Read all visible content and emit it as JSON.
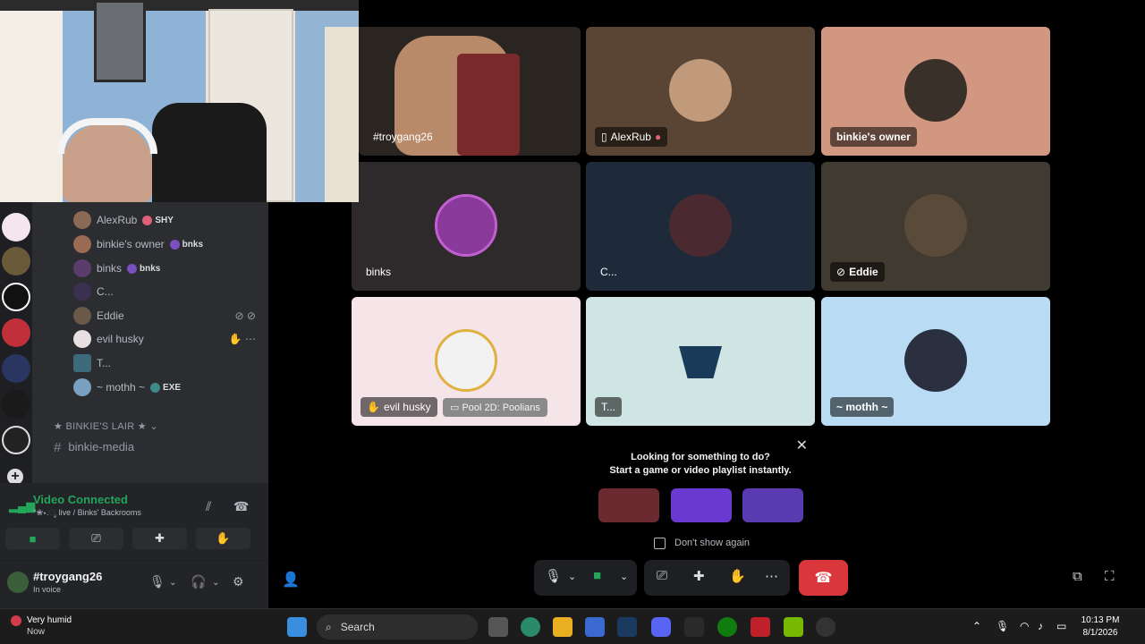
{
  "voice_users": [
    {
      "name": "AlexRub",
      "tag": "SHY",
      "avatar_color": "#8b6a55",
      "tag_color": "#e0607a"
    },
    {
      "name": "binkie's owner",
      "tag": "bnks",
      "avatar_color": "#9a6a55",
      "tag_color": "#7a4fbf"
    },
    {
      "name": "binks",
      "tag": "bnks",
      "avatar_color": "#5a3d6a",
      "tag_color": "#7a4fbf"
    },
    {
      "name": "C...",
      "tag": "",
      "avatar_color": "#3a3050",
      "tag_color": ""
    },
    {
      "name": "Eddie",
      "tag": "",
      "avatar_color": "#6b5a4a",
      "tag_color": ""
    },
    {
      "name": "evil husky",
      "tag": "",
      "avatar_color": "#e8e0e0",
      "tag_color": ""
    },
    {
      "name": "T...",
      "tag": "",
      "avatar_color": "#3c6a7a",
      "tag_color": ""
    },
    {
      "name": "~ mothh ~",
      "tag": "EXE",
      "avatar_color": "#7aa0c0",
      "tag_color": "#3c8a8a"
    }
  ],
  "channels": {
    "category": "★ BINKIE'S LAIR ★",
    "text_channel": "binkie-media"
  },
  "voice_panel": {
    "status": "Video Connected",
    "location": "°❀⋆.ೃ live / Binks' Backrooms"
  },
  "user_bar": {
    "username": "#troygang26",
    "status": "In voice"
  },
  "tiles": [
    {
      "name": "#troygang26"
    },
    {
      "name": "AlexRub"
    },
    {
      "name": "binkie's owner"
    },
    {
      "name": "binks"
    },
    {
      "name": "C..."
    },
    {
      "name": "Eddie"
    },
    {
      "name": "evil husky",
      "activity": "Pool 2D: Poolians"
    },
    {
      "name": "T..."
    },
    {
      "name": "~ mothh ~"
    }
  ],
  "activity_popup": {
    "line1": "Looking for something to do?",
    "line2": "Start a game or video playlist instantly.",
    "dont_show": "Don't show again"
  },
  "taskbar": {
    "weather_title": "Very humid",
    "weather_sub": "Now",
    "search": "Search",
    "time": "10:13 PM",
    "date": "8/1/2026"
  },
  "icons": {
    "mic": "🎙",
    "video": "▶",
    "screen_share": "⎚",
    "activities": "✚",
    "soundboard": "✋",
    "more": "⋯",
    "hangup": "☎",
    "settings": "⚙",
    "headphones": "🎧",
    "popout": "⧉",
    "fullscreen": "⛶"
  }
}
